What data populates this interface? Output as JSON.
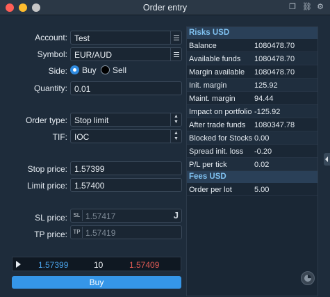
{
  "window": {
    "title": "Order entry"
  },
  "form": {
    "account_label": "Account:",
    "account_value": "Test",
    "symbol_label": "Symbol:",
    "symbol_value": "EUR/AUD",
    "side_label": "Side:",
    "side_buy": "Buy",
    "side_sell": "Sell",
    "side_selected": "Buy",
    "quantity_label": "Quantity:",
    "quantity_value": "0.01",
    "order_type_label": "Order type:",
    "order_type_value": "Stop limit",
    "tif_label": "TIF:",
    "tif_value": "IOC",
    "stop_price_label": "Stop price:",
    "stop_price_value": "1.57399",
    "limit_price_label": "Limit price:",
    "limit_price_value": "1.57400",
    "sl_label": "SL price:",
    "sl_prefix": "SL",
    "sl_value": "1.57417",
    "tp_label": "TP price:",
    "tp_prefix": "TP",
    "tp_value": "1.57419"
  },
  "ticker": {
    "bid": "1.57399",
    "quantity": "10",
    "ask": "1.57409"
  },
  "buy_button": "Buy",
  "risks": {
    "title": "Risks USD",
    "rows": [
      {
        "key": "Balance",
        "value": "1080478.70"
      },
      {
        "key": "Available funds",
        "value": "1080478.70"
      },
      {
        "key": "Margin available",
        "value": "1080478.70"
      },
      {
        "key": "Init. margin",
        "value": "125.92"
      },
      {
        "key": "Maint. margin",
        "value": "94.44"
      },
      {
        "key": "Impact on portfolio",
        "value": "-125.92"
      },
      {
        "key": "After trade funds",
        "value": "1080347.78"
      },
      {
        "key": "Blocked for Stocks",
        "value": "0.00"
      },
      {
        "key": "Spread init. loss",
        "value": "-0.20"
      },
      {
        "key": "P/L per tick",
        "value": "0.02"
      }
    ]
  },
  "fees": {
    "title": "Fees USD",
    "rows": [
      {
        "key": "Order per lot",
        "value": "5.00"
      }
    ]
  },
  "icons": {
    "titlebar": [
      "copy-icon",
      "link-icon",
      "settings-icon"
    ],
    "colors": {
      "accent": "#3596e8",
      "bid": "#4aa3ea",
      "ask": "#e35b55"
    }
  }
}
